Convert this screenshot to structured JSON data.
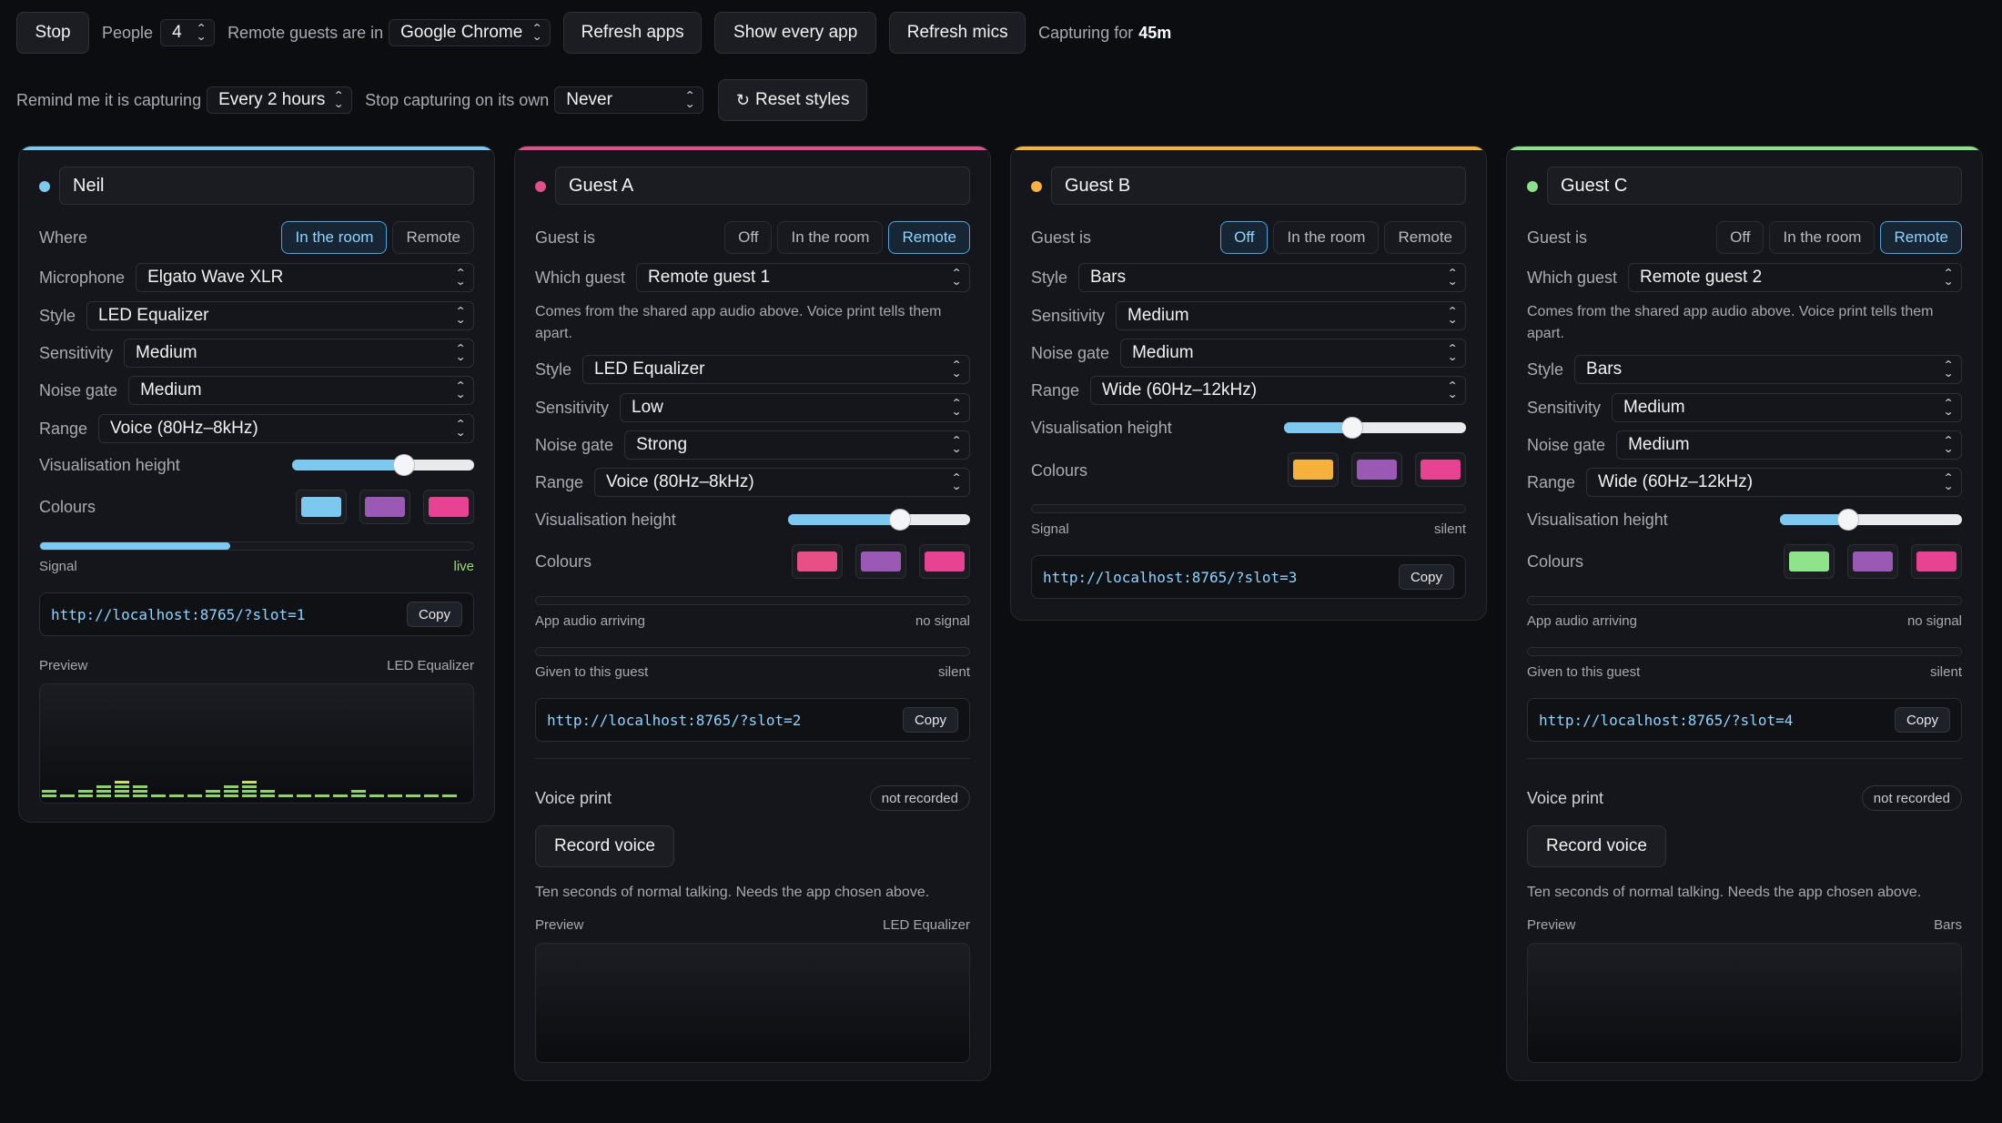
{
  "toolbar": {
    "stop": "Stop",
    "people_label": "People",
    "people_value": "4",
    "remote_label": "Remote guests are in",
    "remote_app": "Google Chrome",
    "refresh_apps": "Refresh apps",
    "show_every_app": "Show every app",
    "refresh_mics": "Refresh mics",
    "capturing_label": "Capturing for",
    "capturing_value": "45m",
    "remind_label": "Remind me it is capturing",
    "remind_value": "Every 2 hours",
    "stop_own_label": "Stop capturing on its own",
    "stop_own_value": "Never",
    "reset_styles": "Reset styles",
    "reset_icon": "refresh-icon"
  },
  "labels": {
    "where": "Where",
    "guest_is": "Guest is",
    "microphone": "Microphone",
    "which_guest": "Which guest",
    "style": "Style",
    "sensitivity": "Sensitivity",
    "noise_gate": "Noise gate",
    "range": "Range",
    "vis_height": "Visualisation height",
    "colours": "Colours",
    "signal": "Signal",
    "app_audio": "App audio arriving",
    "given": "Given to this guest",
    "preview": "Preview",
    "voice_print": "Voice print",
    "record_voice": "Record voice",
    "copy": "Copy",
    "off": "Off",
    "in_room": "In the room",
    "remote": "Remote",
    "shared_note": "Comes from the shared app audio above. Voice print tells them apart.",
    "record_note": "Ten seconds of normal talking. Needs the app chosen above."
  },
  "cards": [
    {
      "name": "Neil",
      "accent": "#7cc8ef",
      "mode": "In the room",
      "microphone": "Elgato Wave XLR",
      "style": "LED Equalizer",
      "sensitivity": "Medium",
      "noise_gate": "Medium",
      "range": "Voice (80Hz–8kHz)",
      "vis_height_fraction": 0.63,
      "colours": [
        "#7cc8ef",
        "#9b59b6",
        "#e84393"
      ],
      "signal_fraction": 0.44,
      "signal_status": "live",
      "url": "http://localhost:8765/?slot=1",
      "preview_style": "LED Equalizer"
    },
    {
      "name": "Guest A",
      "accent": "#e0508a",
      "mode": "Remote",
      "which_guest": "Remote guest 1",
      "style": "LED Equalizer",
      "sensitivity": "Low",
      "noise_gate": "Strong",
      "range": "Voice (80Hz–8kHz)",
      "vis_height_fraction": 0.63,
      "colours": [
        "#e84f86",
        "#9b59b6",
        "#e84393"
      ],
      "app_audio_status": "no signal",
      "given_status": "silent",
      "url": "http://localhost:8765/?slot=2",
      "voice_print_status": "not recorded",
      "preview_style": "LED Equalizer"
    },
    {
      "name": "Guest B",
      "accent": "#f4b23f",
      "mode": "Off",
      "style": "Bars",
      "sensitivity": "Medium",
      "noise_gate": "Medium",
      "range": "Wide (60Hz–12kHz)",
      "vis_height_fraction": 0.36,
      "colours": [
        "#f6b03c",
        "#9b59b6",
        "#e84393"
      ],
      "signal_status": "silent",
      "url": "http://localhost:8765/?slot=3"
    },
    {
      "name": "Guest C",
      "accent": "#8be08a",
      "mode": "Remote",
      "which_guest": "Remote guest 2",
      "style": "Bars",
      "sensitivity": "Medium",
      "noise_gate": "Medium",
      "range": "Wide (60Hz–12kHz)",
      "vis_height_fraction": 0.36,
      "colours": [
        "#8fe38a",
        "#9b59b6",
        "#e84393"
      ],
      "app_audio_status": "no signal",
      "given_status": "silent",
      "url": "http://localhost:8765/?slot=4",
      "voice_print_status": "not recorded",
      "preview_style": "Bars"
    }
  ]
}
